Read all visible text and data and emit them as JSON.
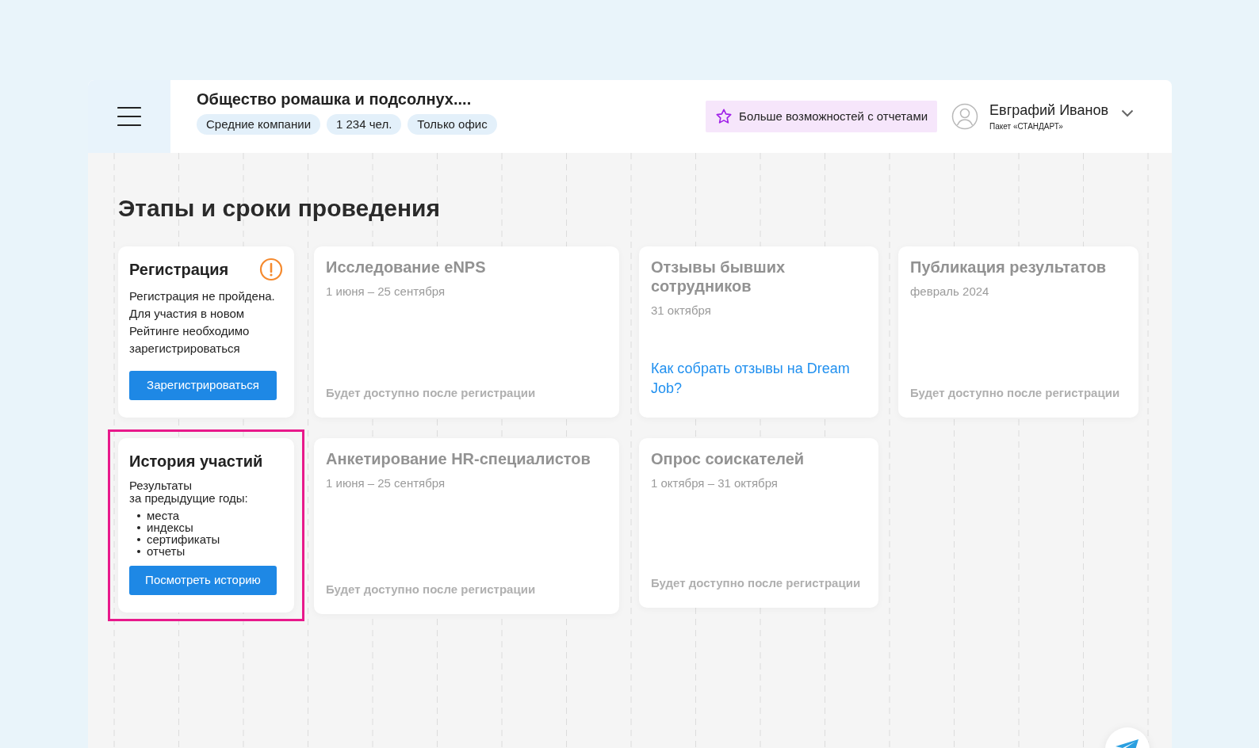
{
  "header": {
    "company": "Общество ромашка и подсолнух....",
    "tags": [
      "Средние компании",
      "1 234 чел.",
      "Только офис"
    ],
    "promo_button": "Больше возможностей с отчетами",
    "user": {
      "name": "Евграфий Иванов",
      "plan": "Пакет «СТАНДАРТ»"
    }
  },
  "page_title": "Этапы и сроки проведения",
  "columns": [
    {
      "cards": [
        {
          "kind": "action",
          "title": "Регистрация",
          "warning": true,
          "highlighted": false,
          "text": "Регистрация не пройдена. Для участия в новом Рейтинге необходимо зарегистрироваться",
          "button": "Зарегистрироваться"
        },
        {
          "kind": "history",
          "title": "История участий",
          "warning": false,
          "highlighted": true,
          "intro": [
            "Результаты",
            "за предыдущие годы:"
          ],
          "bullets": [
            "места",
            "индексы",
            "сертификаты",
            "отчеты"
          ],
          "button": "Посмотреть историю"
        }
      ]
    },
    {
      "cards": [
        {
          "kind": "stage",
          "title": "Исследование eNPS",
          "disabled": true,
          "dates": "1 июня – 25 сентября",
          "note": "Будет доступно после регистрации"
        },
        {
          "kind": "stage",
          "title": "Анкетирование HR-специалистов",
          "disabled": true,
          "dates": "1 июня – 25 сентября",
          "note": "Будет доступно после регистрации"
        }
      ]
    },
    {
      "cards": [
        {
          "kind": "stage",
          "title": "Отзывы бывших сотрудников",
          "disabled": true,
          "dates": "31 октября",
          "link": "Как собрать отзывы на Dream Job?"
        },
        {
          "kind": "stage",
          "title": "Опрос соискателей",
          "disabled": true,
          "dates": "1 октября – 31 октября",
          "note": "Будет доступно после регистрации"
        }
      ]
    },
    {
      "cards": [
        {
          "kind": "stage",
          "title": "Публикация результатов",
          "disabled": true,
          "dates": "февраль 2024",
          "note": "Будет доступно после регистрации"
        }
      ]
    }
  ]
}
